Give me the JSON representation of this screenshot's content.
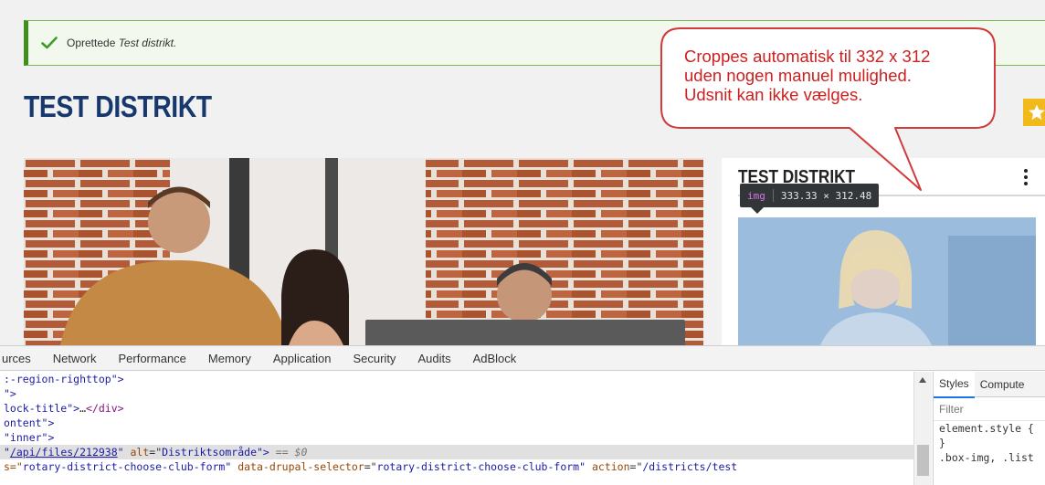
{
  "status": {
    "prefix": "Oprettede ",
    "entity": "Test distrikt."
  },
  "page_title": "TEST DISTRIKT",
  "card": {
    "title": "TEST DISTRIKT"
  },
  "tooltip": {
    "tag": "img",
    "dims": "333.33 × 312.48"
  },
  "callout": {
    "lines": [
      "Croppes automatisk til 332 x 312",
      "uden nogen manuel mulighed.",
      "Udsnit kan ikke vælges."
    ]
  },
  "devtools": {
    "tabs": [
      "urces",
      "Network",
      "Performance",
      "Memory",
      "Application",
      "Security",
      "Audits",
      "AdBlock"
    ],
    "lines": {
      "l1": ":-region-righttop\">",
      "l2": "\">",
      "l3a": "lock-title\">",
      "l3b": "…",
      "l3c": "</div>",
      "l4": "ontent\">",
      "l5": "\"inner\">",
      "l6a": "\"",
      "l6link": "/api/files/212938",
      "l6b": "\" ",
      "l6attr": "alt",
      "l6c": "=\"",
      "l6val": "Distriktsområde",
      "l6d": "\">",
      "l6eq": " == $0",
      "l7a": "s=\"",
      "l7val1": "rotary-district-choose-club-form",
      "l7b": "\" ",
      "l7attr2": "data-drupal-selector",
      "l7c": "=\"",
      "l7val2": "rotary-district-choose-club-form",
      "l7d": "\" ",
      "l7attr3": "action",
      "l7e": "=\"",
      "l7val3": "/districts/test"
    }
  },
  "styles_panel": {
    "tab_styles": "Styles",
    "tab_computed": "Compute",
    "filter": "Filter",
    "rule1": "element.style {",
    "rule1_close": "}",
    "rule2": ".box-img, .list"
  },
  "colors": {
    "title": "#17386d",
    "callout_red": "#cc1f1f",
    "status_green": "#3f8f1f",
    "star_badge": "#f2b91d"
  }
}
